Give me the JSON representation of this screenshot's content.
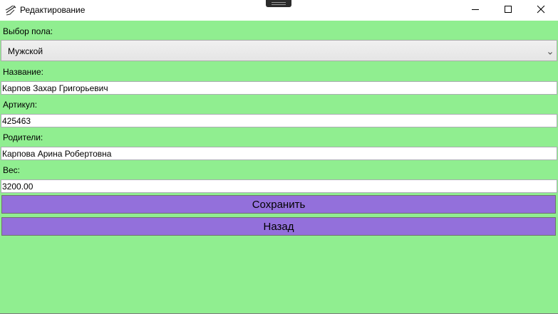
{
  "window": {
    "title": "Редактирование",
    "icon": "app-pen-icon",
    "controls": {
      "minimize_icon": "minimize-icon",
      "maximize_icon": "maximize-icon",
      "close_icon": "close-icon"
    }
  },
  "form": {
    "gender": {
      "label": "Выбор пола:",
      "selected": "Мужской"
    },
    "name": {
      "label": "Название:",
      "value": "Карпов Захар Григорьевич"
    },
    "article": {
      "label": "Артикул:",
      "value": "425463"
    },
    "parents": {
      "label": "Родители:",
      "value": "Карпова Арина Робертовна"
    },
    "weight": {
      "label": "Вес:",
      "value": "3200.00"
    },
    "save_label": "Сохранить",
    "back_label": "Назад"
  },
  "colors": {
    "background": "#90ee90",
    "button": "#9370db",
    "titlebar": "#ffffff"
  }
}
